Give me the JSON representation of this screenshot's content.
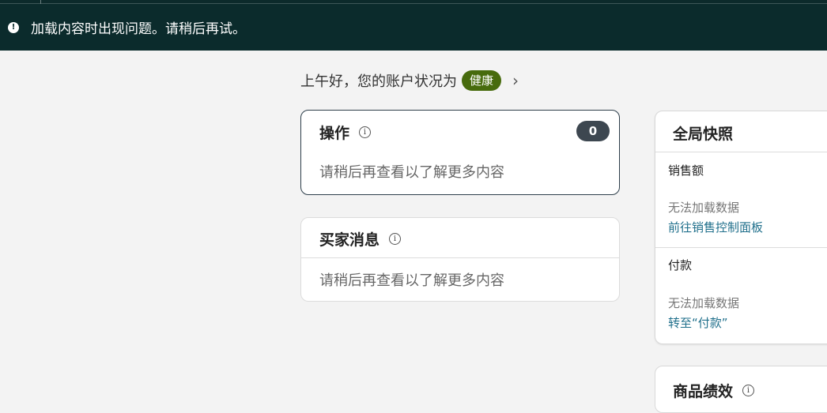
{
  "banner": {
    "icon": "info-icon",
    "message": "加载内容时出现问题。请稍后再试。"
  },
  "greeting": {
    "text": "上午好，您的账户状况为",
    "status": "健康",
    "status_color": "#476b0d"
  },
  "actions_card": {
    "title": "操作",
    "count": "0",
    "message": "请稍后再查看以了解更多内容"
  },
  "buyer_messages_card": {
    "title": "买家消息",
    "message": "请稍后再查看以了解更多内容"
  },
  "global_snapshot": {
    "title": "全局快照",
    "sales": {
      "label": "销售额",
      "status": "无法加载数据",
      "link": "前往销售控制面板"
    },
    "payments": {
      "label": "付款",
      "status": "无法加载数据",
      "link": "转至“付款”"
    }
  },
  "product_performance": {
    "title": "商品绩效"
  },
  "colors": {
    "banner_bg": "#0b2b2c",
    "link": "#1f6f8b",
    "page_bg": "#f3f3f3"
  }
}
